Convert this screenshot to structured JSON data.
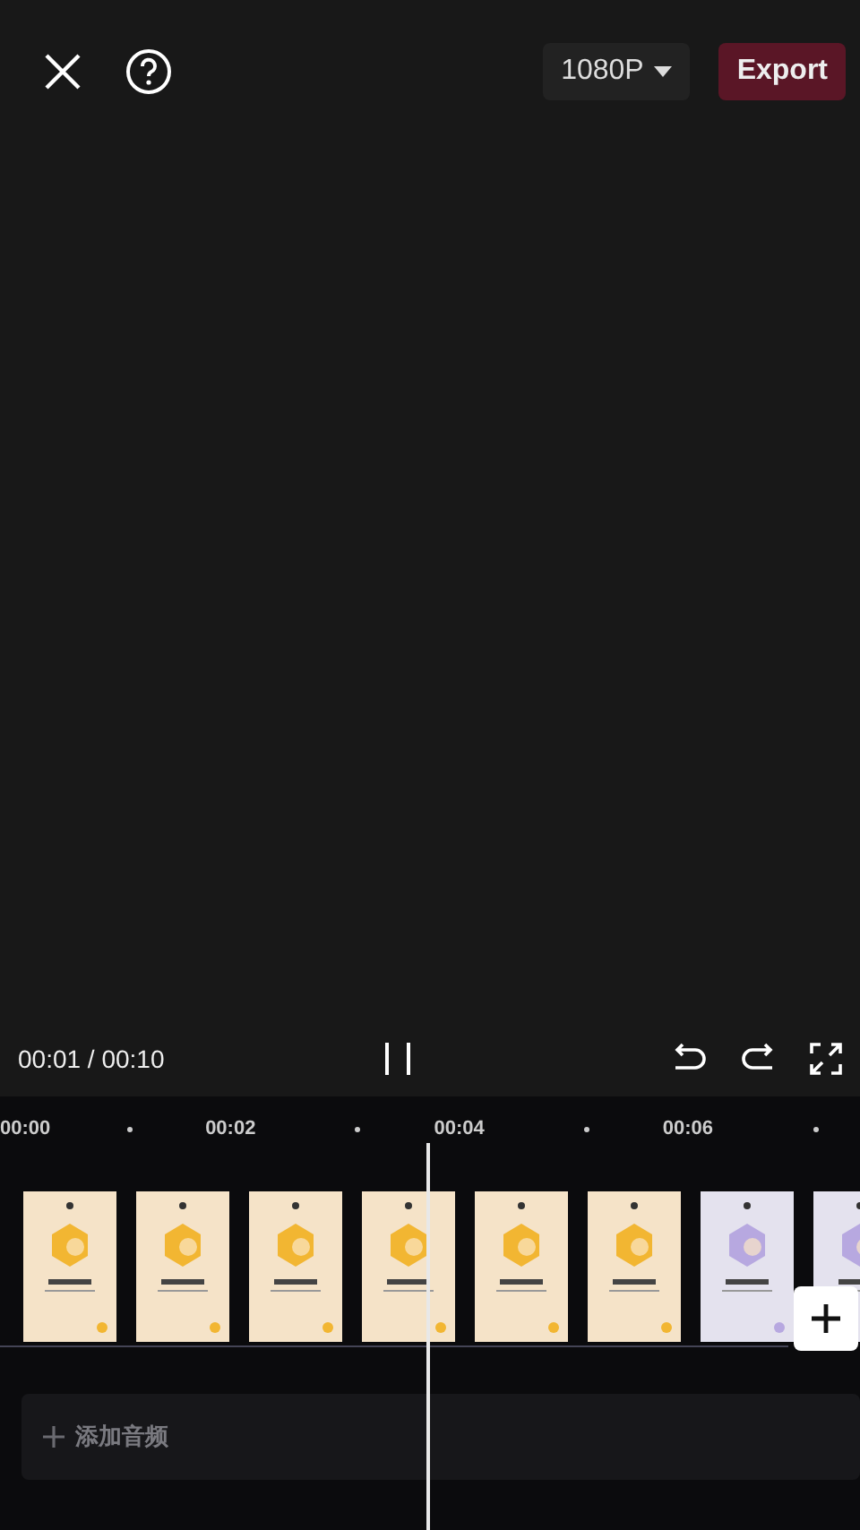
{
  "top_bar": {
    "resolution": "1080P",
    "export_label": "Export"
  },
  "playback": {
    "time": "00:01 / 00:10",
    "playing": true
  },
  "ruler": {
    "marks": [
      "00:00",
      "00:02",
      "00:04",
      "00:06"
    ]
  },
  "clips": [
    {
      "color": "#f5e3c8"
    },
    {
      "color": "#f5e3c8"
    },
    {
      "color": "#f5e3c8"
    },
    {
      "color": "#f5e3c8"
    },
    {
      "color": "#f5e3c8"
    },
    {
      "color": "#f5e3c8"
    },
    {
      "color": "#e4e2ee"
    },
    {
      "color": "#e4e2ee"
    }
  ],
  "audio_track": {
    "label": "添加音频"
  }
}
